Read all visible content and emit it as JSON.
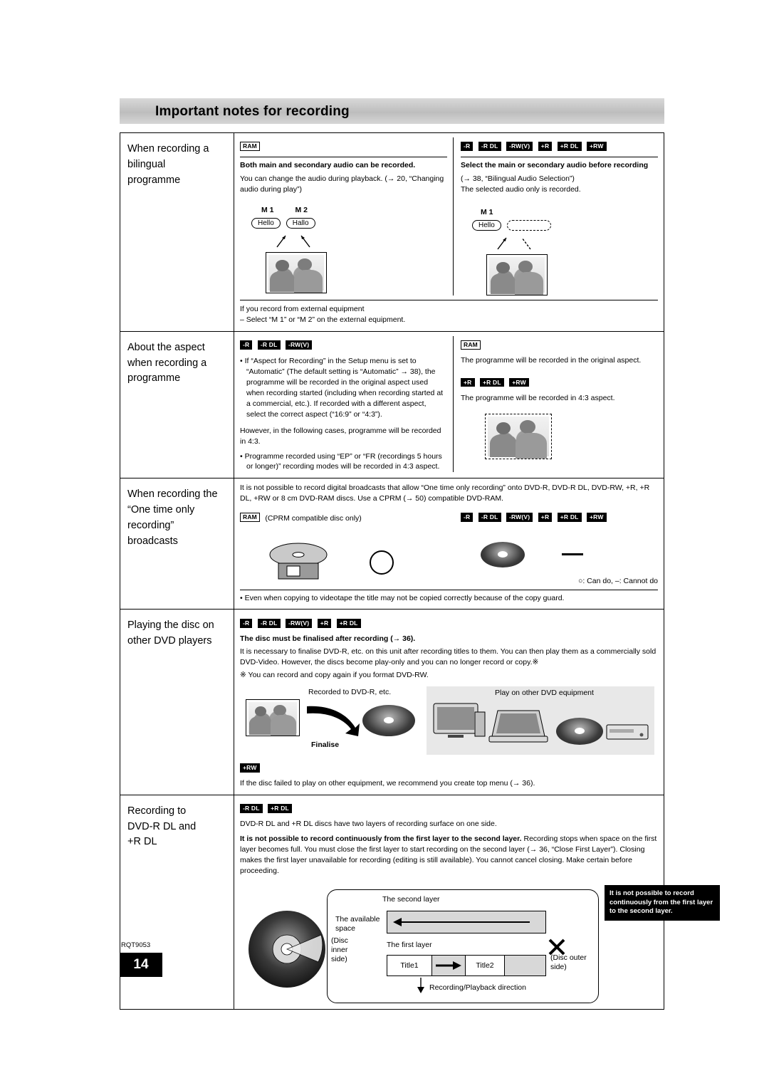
{
  "header": {
    "title": "Important notes for recording"
  },
  "footer": {
    "model_code": "RQT9053",
    "page_number": "14"
  },
  "sections": {
    "bilingual": {
      "title_lines": [
        "When recording a",
        "bilingual",
        "programme"
      ],
      "left": {
        "badges": [
          "RAM"
        ],
        "heading": "Both main and secondary audio can be recorded.",
        "body": "You can change the audio during playback. (→ 20, “Changing audio during play”)",
        "labels": [
          "M 1",
          "M 2"
        ],
        "bubbles": [
          "Hello",
          "Hallo"
        ]
      },
      "right": {
        "badges": [
          "-R",
          "-R DL",
          "-RW(V)",
          "+R",
          "+R DL",
          "+RW"
        ],
        "heading": "Select the main or secondary audio before recording",
        "body1": "(→ 38, “Bilingual Audio Selection”)",
        "body2": "The selected audio only is recorded.",
        "labels": [
          "M 1"
        ],
        "bubbles": [
          "Hello",
          ""
        ]
      },
      "footer1": "If you record from external equipment",
      "footer2": "– Select “M 1” or “M 2” on the external equipment."
    },
    "aspect": {
      "title_lines": [
        "About the aspect",
        "when recording a",
        "programme"
      ],
      "left": {
        "badges": [
          "-R",
          "-R DL",
          "-RW(V)"
        ],
        "bullet1": "If “Aspect for Recording” in the Setup menu is set to “Automatic” (The default setting is “Automatic” → 38), the programme will be recorded in the original aspect used when recording started (including when recording started at a commercial, etc.). If recorded with a different aspect, select the correct aspect (“16:9” or “4:3”).",
        "para2": "However, in the following cases, programme will be recorded in 4:3.",
        "bullet2": "Programme recorded using “EP” or “FR (recordings 5 hours or longer)” recording modes will be recorded in 4:3 aspect."
      },
      "right": {
        "badges_ram": [
          "RAM"
        ],
        "text_ram": "The programme will be recorded in the original aspect.",
        "badges_plus": [
          "+R",
          "+R DL",
          "+RW"
        ],
        "text_plus": "The programme will be recorded in 4:3 aspect."
      }
    },
    "onetime": {
      "title_lines": [
        "When recording the",
        "“One time only",
        "recording”",
        "broadcasts"
      ],
      "intro": "It is not possible to record digital broadcasts that allow “One time only recording” onto DVD-R, DVD-R DL, DVD-RW, +R, +R DL, +RW or 8 cm DVD-RAM discs. Use a CPRM (→ 50) compatible DVD-RAM.",
      "left_badges": [
        "RAM"
      ],
      "left_label": "(CPRM compatible disc only)",
      "right_badges": [
        "-R",
        "-R DL",
        "-RW(V)",
        "+R",
        "+R DL",
        "+RW"
      ],
      "legend": "○: Can do, –: Cannot do",
      "bullet": "Even when copying to videotape the title may not be copied correctly because of the copy guard."
    },
    "otherplayers": {
      "title_lines": [
        "Playing the disc on",
        "other DVD players"
      ],
      "badges": [
        "-R",
        "-R DL",
        "-RW(V)",
        "+R",
        "+R DL"
      ],
      "heading": "The disc must be finalised after recording (→ 36).",
      "body": "It is necessary to finalise DVD-R, etc. on this unit after recording titles to them. You can then play them as a commercially sold DVD-Video. However, the discs become play-only and you can no longer record or copy.※",
      "note": "※ You can record and copy again if you format DVD-RW.",
      "diagram": {
        "label_left": "Recorded to DVD-R, etc.",
        "label_arrow": "Finalise",
        "label_right": "Play on other DVD equipment"
      },
      "badges2": [
        "+RW"
      ],
      "body2": "If the disc failed to play on other equipment, we recommend you create top menu (→ 36)."
    },
    "dl": {
      "title_lines": [
        "Recording to",
        "DVD-R DL and",
        "+R DL"
      ],
      "badges": [
        "-R DL",
        "+R DL"
      ],
      "body1": "DVD-R DL and +R DL discs have two layers of recording surface on one side.",
      "body2_bold": "It is not possible to record continuously from the first layer to the second layer.",
      "body2_rest": " Recording stops when space on the first layer becomes full. You must close the first layer to start recording on the second layer (→ 36, “Close First Layer”). Closing makes the first layer unavailable for recording (editing is still available). You cannot cancel closing. Make certain before proceeding.",
      "diagram": {
        "second_layer": "The second layer",
        "available_space": "The available space",
        "first_layer": "The first layer",
        "title1": "Title1",
        "title2": "Title2",
        "disc_inner": "(Disc inner side)",
        "disc_outer": "(Disc outer side)",
        "direction": "Recording/Playback direction",
        "callout": "It is not possible to record continuously from the first layer to the second layer."
      }
    }
  }
}
